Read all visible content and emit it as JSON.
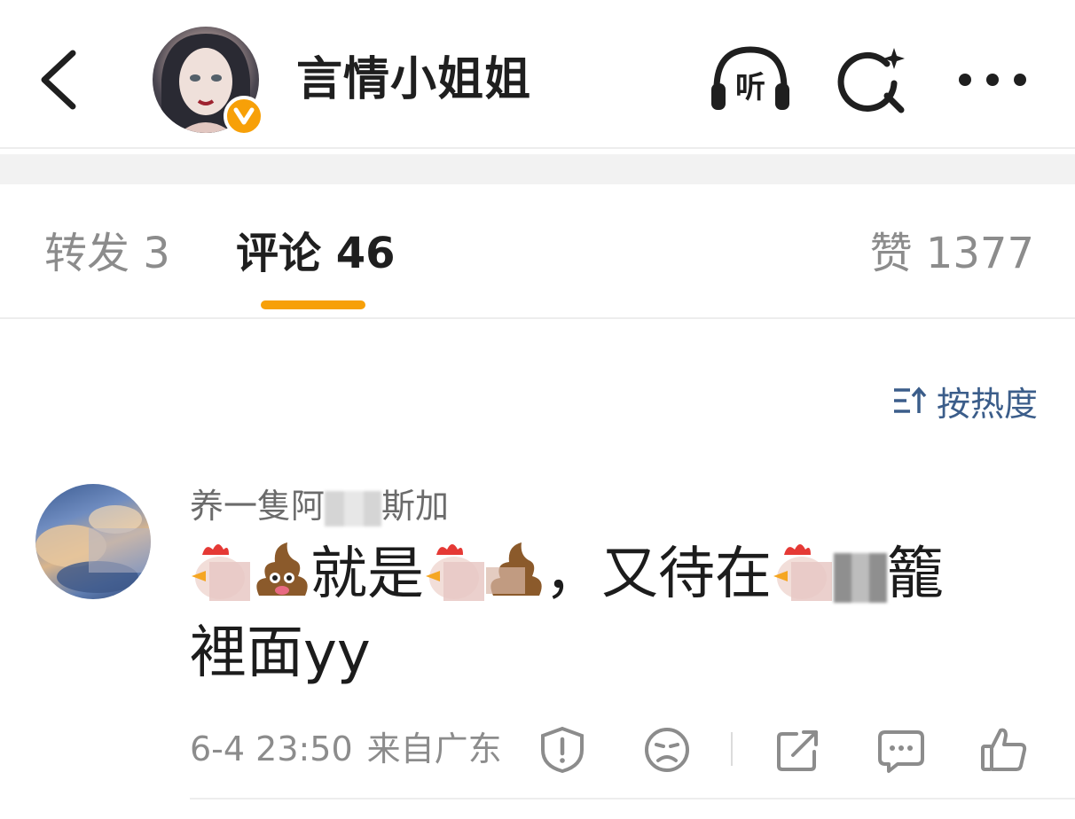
{
  "header": {
    "title": "言情小姐姐",
    "listen_label": "听",
    "icons": {
      "back": "chevron-left-icon",
      "verified": "verified-v-icon",
      "listen": "headphones-icon",
      "search": "search-sparkle-icon",
      "more": "more-dots-icon"
    },
    "verified_letter": "v"
  },
  "tabs": {
    "repost_label": "转发 3",
    "comment_label": "评论 46",
    "like_label": "赞 1377",
    "active": "comment"
  },
  "sort": {
    "label": "按热度",
    "icon": "sort-icon"
  },
  "comment": {
    "username_visible_start": "养一隻阿",
    "username_visible_end": "斯加",
    "text_part1": "就是",
    "text_part2": "，又待在",
    "text_part3": "籠",
    "text_part4": "裡面yy",
    "timestamp": "6-4 23:50",
    "location": "来自广东",
    "actions": [
      "report-icon",
      "dislike-icon",
      "share-icon",
      "reply-icon",
      "like-icon"
    ]
  },
  "colors": {
    "accent": "#f7a008",
    "link": "#3b5d8a",
    "muted": "#8c8c8c"
  }
}
